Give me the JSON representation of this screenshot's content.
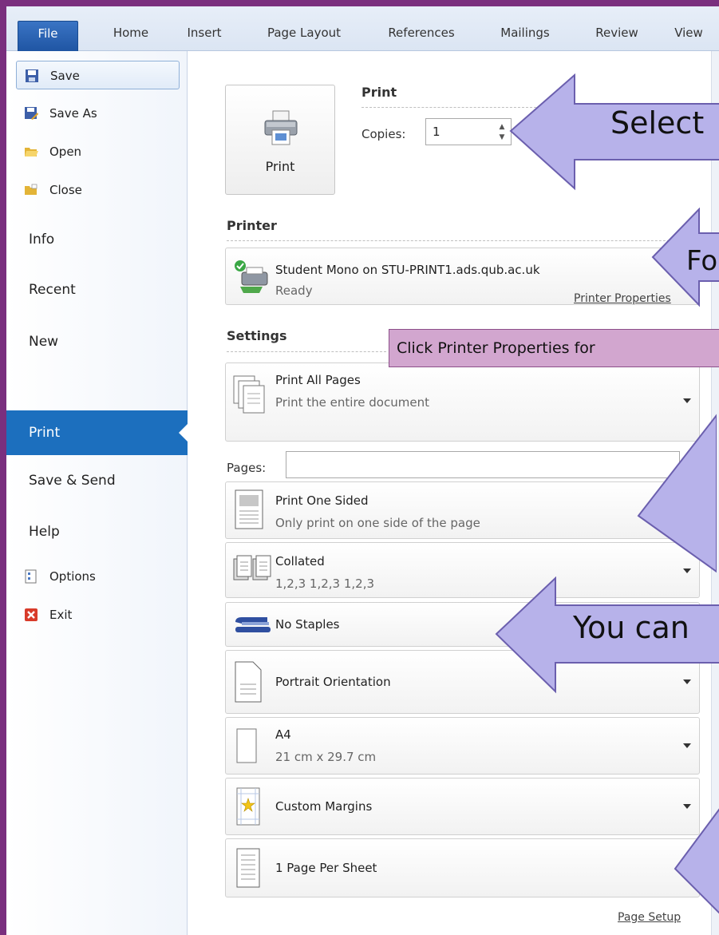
{
  "ribbon": {
    "tabs": [
      "File",
      "Home",
      "Insert",
      "Page Layout",
      "References",
      "Mailings",
      "Review",
      "View"
    ]
  },
  "backstage": {
    "items": {
      "save": "Save",
      "save_as": "Save As",
      "open": "Open",
      "close": "Close",
      "info": "Info",
      "recent": "Recent",
      "new": "New",
      "print": "Print",
      "save_send": "Save & Send",
      "help": "Help",
      "options": "Options",
      "exit": "Exit"
    }
  },
  "print_section": {
    "title": "Print",
    "button_label": "Print",
    "copies_label": "Copies:",
    "copies_value": "1"
  },
  "printer": {
    "title": "Printer",
    "name": "Student Mono on STU-PRINT1.ads.qub.ac.uk",
    "status": "Ready",
    "properties_link": "Printer Properties"
  },
  "settings": {
    "title": "Settings",
    "pages_label": "Pages:",
    "pages_value": "",
    "options": [
      {
        "title": "Print All Pages",
        "sub": "Print the entire document"
      },
      {
        "title": "Print One Sided",
        "sub": "Only print on one side of the page"
      },
      {
        "title": "Collated",
        "sub": "1,2,3   1,2,3   1,2,3"
      },
      {
        "title": "No Staples",
        "sub": ""
      },
      {
        "title": "Portrait Orientation",
        "sub": ""
      },
      {
        "title": "A4",
        "sub": "21 cm x 29.7 cm"
      },
      {
        "title": "Custom Margins",
        "sub": ""
      },
      {
        "title": "1 Page Per Sheet",
        "sub": ""
      }
    ],
    "page_setup_link": "Page Setup"
  },
  "annotations": {
    "select": "Select",
    "fo": "Fo",
    "note": "Click Printer Properties for",
    "you_can": "You can"
  },
  "colors": {
    "print_tab": "#1c6fbe",
    "frame": "#7a2f7e",
    "arrow_fill": "#b7b2ea",
    "arrow_stroke": "#6b5fae",
    "note_fill": "#d2a6cf"
  }
}
